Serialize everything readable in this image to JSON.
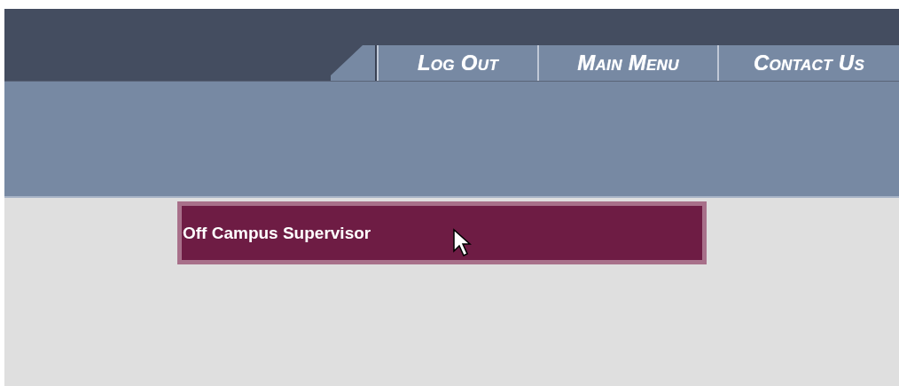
{
  "nav": [
    {
      "label": "Log Out"
    },
    {
      "label": "Main Menu"
    },
    {
      "label": "Contact Us"
    }
  ],
  "role_button": {
    "label": "Off Campus Supervisor"
  }
}
